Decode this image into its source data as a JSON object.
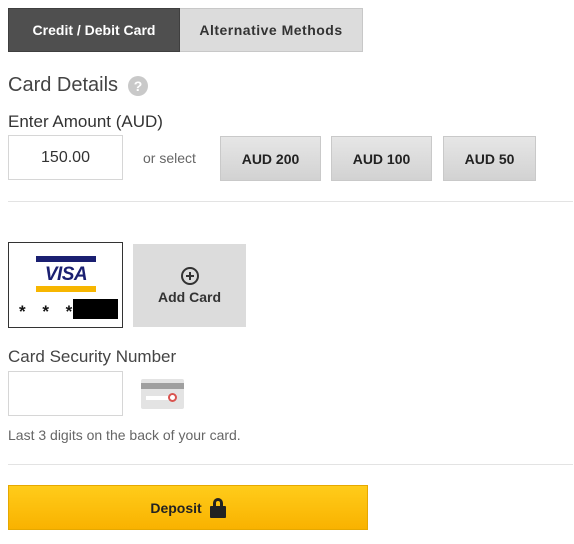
{
  "tabs": {
    "active_label": "Credit / Debit Card",
    "inactive_label": "Alternative Methods"
  },
  "card_details": {
    "heading": "Card Details",
    "help_icon_glyph": "?"
  },
  "amount": {
    "label": "Enter Amount (AUD)",
    "value": "150.00",
    "or_select": "or select",
    "presets": [
      "AUD 200",
      "AUD 100",
      "AUD 50"
    ]
  },
  "saved_card": {
    "brand": "VISA",
    "mask": "* * *"
  },
  "add_card": {
    "label": "Add Card"
  },
  "security": {
    "label": "Card Security Number",
    "value": "",
    "hint": "Last 3 digits on the back of your card."
  },
  "deposit": {
    "label": "Deposit"
  },
  "colors": {
    "tab_active_bg": "#4f4f4f",
    "tab_inactive_bg": "#dcdcdc",
    "deposit_bg": "#fbbd0a",
    "visa_blue": "#1a1f71",
    "visa_gold": "#f7b600"
  }
}
